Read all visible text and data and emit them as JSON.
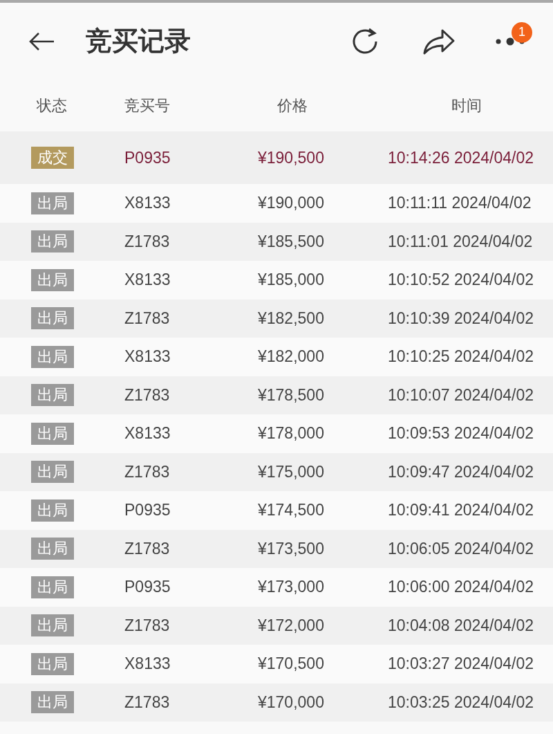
{
  "header": {
    "title": "竞买记录",
    "badge": "1"
  },
  "table": {
    "columns": [
      "状态",
      "竞买号",
      "价格",
      "时间"
    ],
    "rows": [
      {
        "status": "成交",
        "kind": "deal",
        "bidder": "P0935",
        "price": "¥190,500",
        "time": "10:14:26 2024/04/02"
      },
      {
        "status": "出局",
        "kind": "out",
        "bidder": "X8133",
        "price": "¥190,000",
        "time": "10:11:11 2024/04/02"
      },
      {
        "status": "出局",
        "kind": "out",
        "bidder": "Z1783",
        "price": "¥185,500",
        "time": "10:11:01 2024/04/02"
      },
      {
        "status": "出局",
        "kind": "out",
        "bidder": "X8133",
        "price": "¥185,000",
        "time": "10:10:52 2024/04/02"
      },
      {
        "status": "出局",
        "kind": "out",
        "bidder": "Z1783",
        "price": "¥182,500",
        "time": "10:10:39 2024/04/02"
      },
      {
        "status": "出局",
        "kind": "out",
        "bidder": "X8133",
        "price": "¥182,000",
        "time": "10:10:25 2024/04/02"
      },
      {
        "status": "出局",
        "kind": "out",
        "bidder": "Z1783",
        "price": "¥178,500",
        "time": "10:10:07 2024/04/02"
      },
      {
        "status": "出局",
        "kind": "out",
        "bidder": "X8133",
        "price": "¥178,000",
        "time": "10:09:53 2024/04/02"
      },
      {
        "status": "出局",
        "kind": "out",
        "bidder": "Z1783",
        "price": "¥175,000",
        "time": "10:09:47 2024/04/02"
      },
      {
        "status": "出局",
        "kind": "out",
        "bidder": "P0935",
        "price": "¥174,500",
        "time": "10:09:41 2024/04/02"
      },
      {
        "status": "出局",
        "kind": "out",
        "bidder": "Z1783",
        "price": "¥173,500",
        "time": "10:06:05 2024/04/02"
      },
      {
        "status": "出局",
        "kind": "out",
        "bidder": "P0935",
        "price": "¥173,000",
        "time": "10:06:00 2024/04/02"
      },
      {
        "status": "出局",
        "kind": "out",
        "bidder": "Z1783",
        "price": "¥172,000",
        "time": "10:04:08 2024/04/02"
      },
      {
        "status": "出局",
        "kind": "out",
        "bidder": "X8133",
        "price": "¥170,500",
        "time": "10:03:27 2024/04/02"
      },
      {
        "status": "出局",
        "kind": "out",
        "bidder": "Z1783",
        "price": "¥170,000",
        "time": "10:03:25 2024/04/02"
      }
    ]
  }
}
